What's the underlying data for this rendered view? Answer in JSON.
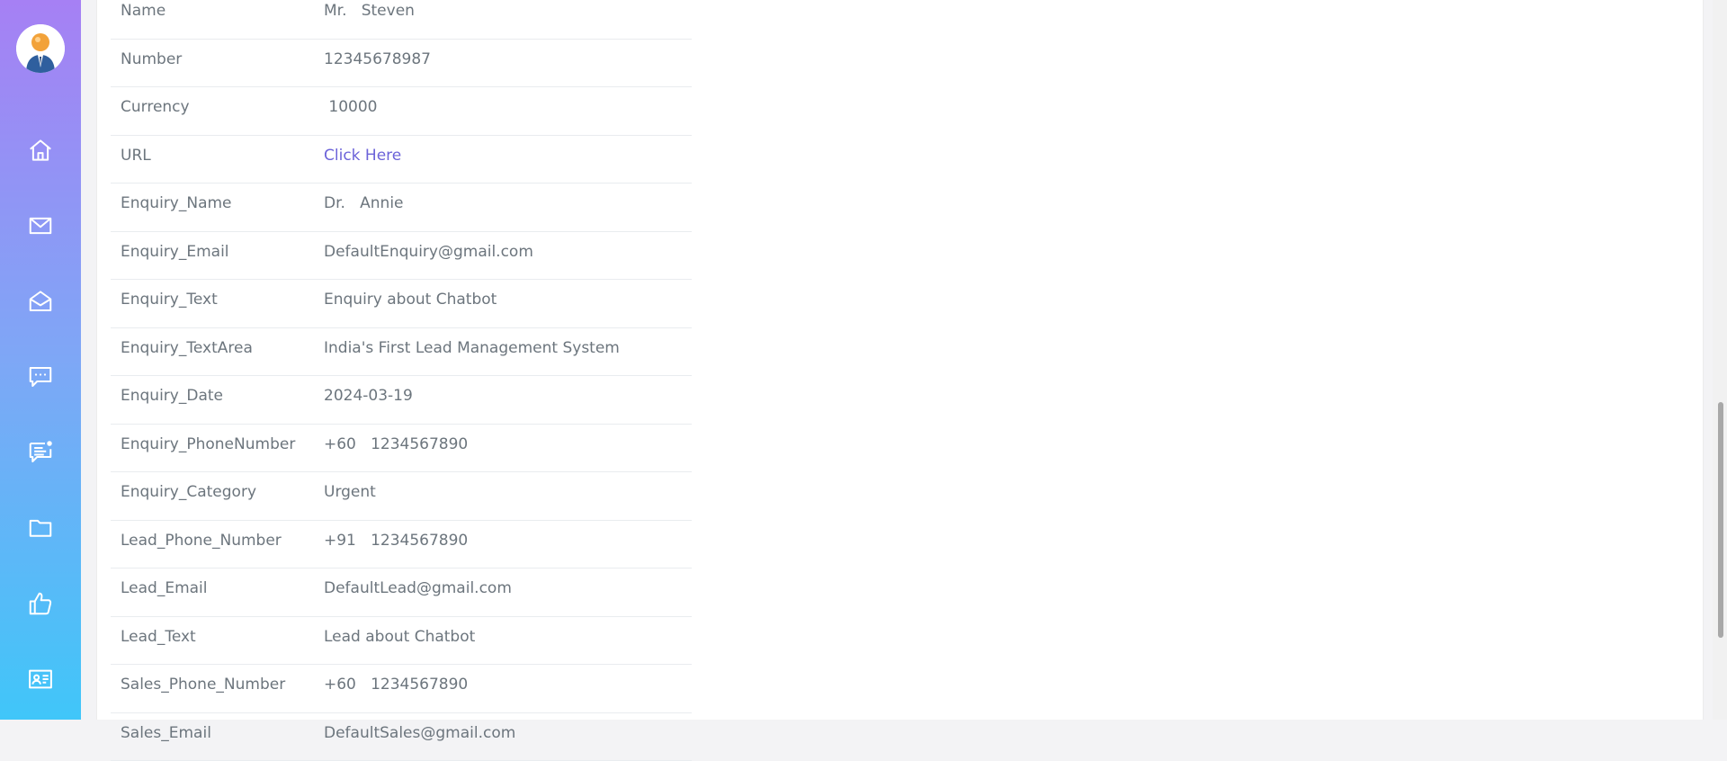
{
  "sidebar": {
    "avatar_icon": "user-avatar-icon",
    "items": [
      {
        "name": "home",
        "icon": "home-icon"
      },
      {
        "name": "mail",
        "icon": "mail-icon"
      },
      {
        "name": "open-mail",
        "icon": "open-mail-icon"
      },
      {
        "name": "chat",
        "icon": "chat-icon"
      },
      {
        "name": "notification-chat",
        "icon": "chat-notification-icon"
      },
      {
        "name": "folder",
        "icon": "folder-icon"
      },
      {
        "name": "like",
        "icon": "thumbs-up-icon"
      },
      {
        "name": "contact-card",
        "icon": "contact-card-icon"
      }
    ],
    "gradient": [
      "#a680f4",
      "#40c6f9"
    ]
  },
  "details": [
    {
      "label": "Name",
      "value": "Mr.   Steven"
    },
    {
      "label": "Number",
      "value": "12345678987"
    },
    {
      "label": "Currency",
      "value": " 10000"
    },
    {
      "label": "URL",
      "value": "Click Here"
    },
    {
      "label": "Enquiry_Name",
      "value": "Dr.   Annie"
    },
    {
      "label": "Enquiry_Email",
      "value": "DefaultEnquiry@gmail.com"
    },
    {
      "label": "Enquiry_Text",
      "value": "Enquiry about Chatbot"
    },
    {
      "label": "Enquiry_TextArea",
      "value": "India's First Lead Management System"
    },
    {
      "label": "Enquiry_Date",
      "value": "2024-03-19"
    },
    {
      "label": "Enquiry_PhoneNumber",
      "value": "+60   1234567890"
    },
    {
      "label": "Enquiry_Category",
      "value": "Urgent"
    },
    {
      "label": "Lead_Phone_Number",
      "value": "+91   1234567890"
    },
    {
      "label": "Lead_Email",
      "value": "DefaultLead@gmail.com"
    },
    {
      "label": "Lead_Text",
      "value": "Lead about Chatbot"
    },
    {
      "label": "Sales_Phone_Number",
      "value": "+60   1234567890"
    },
    {
      "label": "Sales_Email",
      "value": "DefaultSales@gmail.com"
    }
  ],
  "colors": {
    "link": "#6c63d9",
    "text": "#6c757d",
    "divider": "#e9ecef"
  }
}
